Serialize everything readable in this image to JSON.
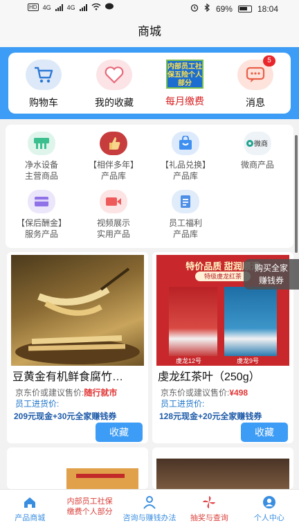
{
  "status_bar": {
    "signal": "4G",
    "signal2": "4G",
    "battery": "69%",
    "time": "18:04"
  },
  "title": "商城",
  "quick_actions": [
    {
      "label": "购物车",
      "icon": "cart-icon"
    },
    {
      "label": "我的收藏",
      "icon": "heart-icon"
    },
    {
      "label": "每月缴费",
      "icon": "insurance-icon",
      "icon_text": "内部员工社保五险个人部分"
    },
    {
      "label": "消息",
      "icon": "message-icon",
      "badge": "5"
    }
  ],
  "categories": [
    {
      "line1": "净水设备",
      "line2": "主营商品",
      "icon": "water-purifier-icon"
    },
    {
      "line1": "【相伴多年】",
      "line2": "产品库",
      "icon": "thumbs-up-icon"
    },
    {
      "line1": "【礼品兑换】",
      "line2": "产品库",
      "icon": "gift-bag-icon"
    },
    {
      "line1": "微商产品",
      "line2": "",
      "icon": "weishang-logo-icon",
      "logo_text": "微商"
    },
    {
      "line1": "【保后酬金】",
      "line2": "服务产品",
      "icon": "card-icon"
    },
    {
      "line1": "视频展示",
      "line2": "实用产品",
      "icon": "video-icon"
    },
    {
      "line1": "员工福利",
      "line2": "产品库",
      "icon": "document-icon"
    }
  ],
  "products": [
    {
      "name": "豆黄金有机鲜食腐竹…",
      "price_label": "京东价或建议售价:",
      "price_value": "随行就市",
      "employee_label": "员工进货价:",
      "employee_price": "209元现金+30元全家赚钱券",
      "fav": "收藏",
      "image": "yuba-photo"
    },
    {
      "name": "虔龙红茶叶（250g）",
      "price_label": "京东价或建议售价:",
      "price_value": "¥498",
      "employee_label": "员工进货价:",
      "employee_price": "128元现金+20元全家赚钱券",
      "fav": "收藏",
      "image": "tea-box-photo",
      "banner_text": "特价品质 甜润顺滑",
      "sub_banner": "特级虔龙红茶",
      "box1": "虔龙12号",
      "box2": "虔龙9号"
    }
  ],
  "float_button": {
    "line1": "购买全家",
    "line2": "赚钱券"
  },
  "bottom_nav": [
    {
      "label": "产品商城",
      "icon": "home-icon"
    },
    {
      "label": "内部员工社保缴费个人部分",
      "line1": "内部员工社保",
      "line2": "缴费个人部分",
      "icon": ""
    },
    {
      "label": "咨询与赚钱办法",
      "icon": "person-icon"
    },
    {
      "label": "抽奖与查询",
      "icon": "pinwheel-icon"
    },
    {
      "label": "个人中心",
      "icon": "user-circle-icon"
    }
  ],
  "colors": {
    "primary": "#3d9cf5",
    "price_red": "#e23636",
    "badge_red": "#e8262b",
    "nav_blue": "#3a8ee0"
  }
}
